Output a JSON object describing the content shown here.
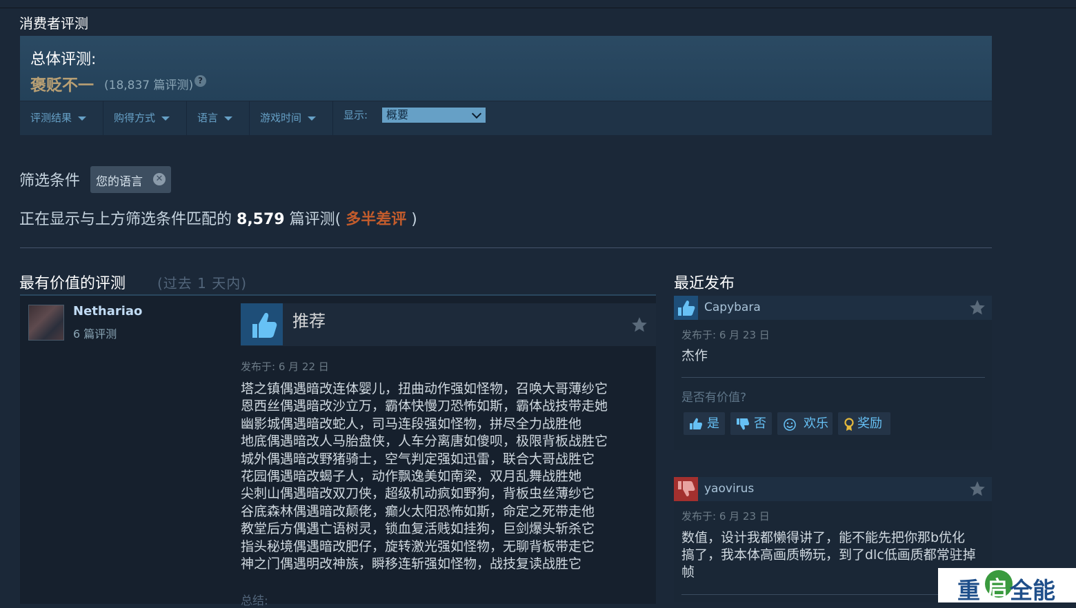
{
  "section_title": "消费者评测",
  "summary": {
    "label": "总体评测:",
    "score": "褒贬不一",
    "count": "(18,837 篇评测)",
    "help_glyph": "?"
  },
  "filter_bar": {
    "items": [
      "评测结果",
      "购得方式",
      "语言",
      "游戏时间"
    ],
    "display_label": "显示:",
    "display_value": "概要"
  },
  "active_filters": {
    "title": "筛选条件",
    "chip": "您的语言",
    "chip_close": "✕"
  },
  "match_line": {
    "prefix": "正在显示与上方筛选条件匹配的",
    "count": "8,579",
    "suffix": "篇评测",
    "open": "(",
    "verdict": "多半差评",
    "close": ")"
  },
  "helpful": {
    "title": "最有价值的评测",
    "subtitle": "(过去 1 天内)",
    "review": {
      "author": "Nethariao",
      "author_reviews": "6 篇评测",
      "verdict": "推荐",
      "posted": "发布于: 6 月 22 日",
      "body": [
        "塔之镇偶遇暗改连体婴儿，扭曲动作强如怪物，召唤大哥薄纱它",
        "恩西丝偶遇暗改沙立万，霸体快慢刀恐怖如斯，霸体战技带走她",
        "幽影城偶遇暗改蛇人，司马连段强如怪物，拼尽全力战胜他",
        "地底偶遇暗改人马胎盘侠，人车分离唐如傻呗，极限背板战胜它",
        "城外偶遇暗改野猪骑士，空气判定强如迅雷，联合大哥战胜它",
        "花园偶遇暗改蝎子人，动作飘逸美如南梁，双月乱舞战胜她",
        "尖刺山偶遇暗改双刀侠，超级机动疯如野狗，背板虫丝薄纱它",
        "谷底森林偶遇暗改颠佬，癫火太阳恐怖如斯，命定之死带走他",
        "教堂后方偶遇亡语树灵，锁血复活贱如挂狗，巨剑爆头斩杀它",
        "指头秘境偶遇暗改肥仔，旋转激光强如怪物，无聊背板带走它",
        "神之门偶遇明改神族，瞬移连斩强如怪物，战技复读战胜它"
      ],
      "summary_label": "总结:"
    }
  },
  "recent": {
    "title": "最近发布",
    "reviews": [
      {
        "author": "Capybara",
        "sentiment": "positive",
        "posted": "发布于: 6 月 23 日",
        "body": [
          "杰作"
        ],
        "helpful_q": "是否有价值?",
        "votes": [
          "是",
          "否",
          "欢乐",
          "奖励"
        ]
      },
      {
        "author": "yaovirus",
        "sentiment": "negative",
        "posted": "发布于: 6 月 23 日",
        "body": [
          "数值，设计我都懒得讲了，能不能先把你那b优化",
          "搞了，我本体高画质畅玩，到了dlc低画质都常驻掉",
          "帧"
        ]
      }
    ]
  },
  "watermark": {
    "left": "重",
    "circle": "启",
    "right": "全能"
  },
  "colors": {
    "background": "#1b2838",
    "mixed": "#b9a074",
    "negative": "#c35c2c",
    "link": "#66c0f4",
    "thumb_up_bg": "#1e4e78",
    "thumb_down_bg": "#a3302e"
  }
}
